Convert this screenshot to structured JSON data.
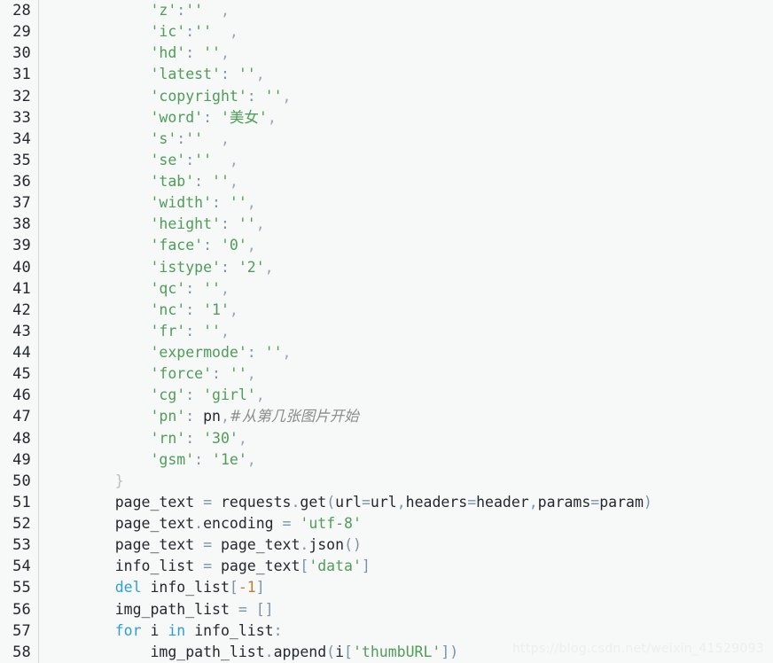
{
  "editor": {
    "language": "python",
    "background_color": "#f7f8f8",
    "gutter_separator_color": "#d4d6d9",
    "first_line_number": 28,
    "last_line_number": 58,
    "colors": {
      "string": "#4f9d58",
      "keyword": "#2d9fd6",
      "operator": "#7b93a8",
      "number": "#c07c32",
      "comment": "#8b8b8b",
      "identifier": "#24292e",
      "line_number": "#24292e",
      "brace": "#b9bec4"
    }
  },
  "watermark": {
    "text": "https://blog.csdn.net/weixin_41529093"
  },
  "lines": [
    {
      "n": "28",
      "text": "        'z':''  ,"
    },
    {
      "n": "29",
      "text": "        'ic':''  ,"
    },
    {
      "n": "30",
      "text": "        'hd': '',"
    },
    {
      "n": "31",
      "text": "        'latest': '',"
    },
    {
      "n": "32",
      "text": "        'copyright': '',"
    },
    {
      "n": "33",
      "text": "        'word': '美女',"
    },
    {
      "n": "34",
      "text": "        's':''  ,"
    },
    {
      "n": "35",
      "text": "        'se':''  ,"
    },
    {
      "n": "36",
      "text": "        'tab': '',"
    },
    {
      "n": "37",
      "text": "        'width': '',"
    },
    {
      "n": "38",
      "text": "        'height': '',"
    },
    {
      "n": "39",
      "text": "        'face': '0',"
    },
    {
      "n": "40",
      "text": "        'istype': '2',"
    },
    {
      "n": "41",
      "text": "        'qc': '',"
    },
    {
      "n": "42",
      "text": "        'nc': '1',"
    },
    {
      "n": "43",
      "text": "        'fr': '',"
    },
    {
      "n": "44",
      "text": "        'expermode': '',"
    },
    {
      "n": "45",
      "text": "        'force': '',"
    },
    {
      "n": "46",
      "text": "        'cg': 'girl',"
    },
    {
      "n": "47",
      "text": "        'pn': pn,#从第几张图片开始"
    },
    {
      "n": "48",
      "text": "        'rn': '30',"
    },
    {
      "n": "49",
      "text": "        'gsm': '1e',"
    },
    {
      "n": "50",
      "text": "    }"
    },
    {
      "n": "51",
      "text": "    page_text = requests.get(url=url,headers=header,params=param)"
    },
    {
      "n": "52",
      "text": "    page_text.encoding = 'utf-8'"
    },
    {
      "n": "53",
      "text": "    page_text = page_text.json()"
    },
    {
      "n": "54",
      "text": "    info_list = page_text['data']"
    },
    {
      "n": "55",
      "text": "    del info_list[-1]"
    },
    {
      "n": "56",
      "text": "    img_path_list = []"
    },
    {
      "n": "57",
      "text": "    for i in info_list:"
    },
    {
      "n": "58",
      "text": "        img_path_list.append(i['thumbURL'])"
    }
  ],
  "tokens": {
    "28": [
      {
        "c": "plain",
        "t": "        "
      },
      {
        "c": "tok-str",
        "t": "'z'"
      },
      {
        "c": "tok-op",
        "t": ":"
      },
      {
        "c": "tok-str",
        "t": "''"
      },
      {
        "c": "plain",
        "t": "  "
      },
      {
        "c": "tok-punc",
        "t": ","
      }
    ],
    "29": [
      {
        "c": "plain",
        "t": "        "
      },
      {
        "c": "tok-str",
        "t": "'ic'"
      },
      {
        "c": "tok-op",
        "t": ":"
      },
      {
        "c": "tok-str",
        "t": "''"
      },
      {
        "c": "plain",
        "t": "  "
      },
      {
        "c": "tok-punc",
        "t": ","
      }
    ],
    "30": [
      {
        "c": "plain",
        "t": "        "
      },
      {
        "c": "tok-str",
        "t": "'hd'"
      },
      {
        "c": "tok-op",
        "t": ":"
      },
      {
        "c": "plain",
        "t": " "
      },
      {
        "c": "tok-str",
        "t": "''"
      },
      {
        "c": "tok-punc",
        "t": ","
      }
    ],
    "31": [
      {
        "c": "plain",
        "t": "        "
      },
      {
        "c": "tok-str",
        "t": "'latest'"
      },
      {
        "c": "tok-op",
        "t": ":"
      },
      {
        "c": "plain",
        "t": " "
      },
      {
        "c": "tok-str",
        "t": "''"
      },
      {
        "c": "tok-punc",
        "t": ","
      }
    ],
    "32": [
      {
        "c": "plain",
        "t": "        "
      },
      {
        "c": "tok-str",
        "t": "'copyright'"
      },
      {
        "c": "tok-op",
        "t": ":"
      },
      {
        "c": "plain",
        "t": " "
      },
      {
        "c": "tok-str",
        "t": "''"
      },
      {
        "c": "tok-punc",
        "t": ","
      }
    ],
    "33": [
      {
        "c": "plain",
        "t": "        "
      },
      {
        "c": "tok-str",
        "t": "'word'"
      },
      {
        "c": "tok-op",
        "t": ":"
      },
      {
        "c": "plain",
        "t": " "
      },
      {
        "c": "tok-str",
        "t": "'"
      },
      {
        "c": "tok-cn",
        "t": "美女"
      },
      {
        "c": "tok-str",
        "t": "'"
      },
      {
        "c": "tok-punc",
        "t": ","
      }
    ],
    "34": [
      {
        "c": "plain",
        "t": "        "
      },
      {
        "c": "tok-str",
        "t": "'s'"
      },
      {
        "c": "tok-op",
        "t": ":"
      },
      {
        "c": "tok-str",
        "t": "''"
      },
      {
        "c": "plain",
        "t": "  "
      },
      {
        "c": "tok-punc",
        "t": ","
      }
    ],
    "35": [
      {
        "c": "plain",
        "t": "        "
      },
      {
        "c": "tok-str",
        "t": "'se'"
      },
      {
        "c": "tok-op",
        "t": ":"
      },
      {
        "c": "tok-str",
        "t": "''"
      },
      {
        "c": "plain",
        "t": "  "
      },
      {
        "c": "tok-punc",
        "t": ","
      }
    ],
    "36": [
      {
        "c": "plain",
        "t": "        "
      },
      {
        "c": "tok-str",
        "t": "'tab'"
      },
      {
        "c": "tok-op",
        "t": ":"
      },
      {
        "c": "plain",
        "t": " "
      },
      {
        "c": "tok-str",
        "t": "''"
      },
      {
        "c": "tok-punc",
        "t": ","
      }
    ],
    "37": [
      {
        "c": "plain",
        "t": "        "
      },
      {
        "c": "tok-str",
        "t": "'width'"
      },
      {
        "c": "tok-op",
        "t": ":"
      },
      {
        "c": "plain",
        "t": " "
      },
      {
        "c": "tok-str",
        "t": "''"
      },
      {
        "c": "tok-punc",
        "t": ","
      }
    ],
    "38": [
      {
        "c": "plain",
        "t": "        "
      },
      {
        "c": "tok-str",
        "t": "'height'"
      },
      {
        "c": "tok-op",
        "t": ":"
      },
      {
        "c": "plain",
        "t": " "
      },
      {
        "c": "tok-str",
        "t": "''"
      },
      {
        "c": "tok-punc",
        "t": ","
      }
    ],
    "39": [
      {
        "c": "plain",
        "t": "        "
      },
      {
        "c": "tok-str",
        "t": "'face'"
      },
      {
        "c": "tok-op",
        "t": ":"
      },
      {
        "c": "plain",
        "t": " "
      },
      {
        "c": "tok-str",
        "t": "'0'"
      },
      {
        "c": "tok-punc",
        "t": ","
      }
    ],
    "40": [
      {
        "c": "plain",
        "t": "        "
      },
      {
        "c": "tok-str",
        "t": "'istype'"
      },
      {
        "c": "tok-op",
        "t": ":"
      },
      {
        "c": "plain",
        "t": " "
      },
      {
        "c": "tok-str",
        "t": "'2'"
      },
      {
        "c": "tok-punc",
        "t": ","
      }
    ],
    "41": [
      {
        "c": "plain",
        "t": "        "
      },
      {
        "c": "tok-str",
        "t": "'qc'"
      },
      {
        "c": "tok-op",
        "t": ":"
      },
      {
        "c": "plain",
        "t": " "
      },
      {
        "c": "tok-str",
        "t": "''"
      },
      {
        "c": "tok-punc",
        "t": ","
      }
    ],
    "42": [
      {
        "c": "plain",
        "t": "        "
      },
      {
        "c": "tok-str",
        "t": "'nc'"
      },
      {
        "c": "tok-op",
        "t": ":"
      },
      {
        "c": "plain",
        "t": " "
      },
      {
        "c": "tok-str",
        "t": "'1'"
      },
      {
        "c": "tok-punc",
        "t": ","
      }
    ],
    "43": [
      {
        "c": "plain",
        "t": "        "
      },
      {
        "c": "tok-str",
        "t": "'fr'"
      },
      {
        "c": "tok-op",
        "t": ":"
      },
      {
        "c": "plain",
        "t": " "
      },
      {
        "c": "tok-str",
        "t": "''"
      },
      {
        "c": "tok-punc",
        "t": ","
      }
    ],
    "44": [
      {
        "c": "plain",
        "t": "        "
      },
      {
        "c": "tok-str",
        "t": "'expermode'"
      },
      {
        "c": "tok-op",
        "t": ":"
      },
      {
        "c": "plain",
        "t": " "
      },
      {
        "c": "tok-str",
        "t": "''"
      },
      {
        "c": "tok-punc",
        "t": ","
      }
    ],
    "45": [
      {
        "c": "plain",
        "t": "        "
      },
      {
        "c": "tok-str",
        "t": "'force'"
      },
      {
        "c": "tok-op",
        "t": ":"
      },
      {
        "c": "plain",
        "t": " "
      },
      {
        "c": "tok-str",
        "t": "''"
      },
      {
        "c": "tok-punc",
        "t": ","
      }
    ],
    "46": [
      {
        "c": "plain",
        "t": "        "
      },
      {
        "c": "tok-str",
        "t": "'cg'"
      },
      {
        "c": "tok-op",
        "t": ":"
      },
      {
        "c": "plain",
        "t": " "
      },
      {
        "c": "tok-str",
        "t": "'girl'"
      },
      {
        "c": "tok-punc",
        "t": ","
      }
    ],
    "47": [
      {
        "c": "plain",
        "t": "        "
      },
      {
        "c": "tok-str",
        "t": "'pn'"
      },
      {
        "c": "tok-op",
        "t": ":"
      },
      {
        "c": "plain",
        "t": " "
      },
      {
        "c": "tok-id",
        "t": "pn"
      },
      {
        "c": "tok-punc",
        "t": ","
      },
      {
        "c": "tok-cmt",
        "t": "#从第几张图片开始"
      }
    ],
    "48": [
      {
        "c": "plain",
        "t": "        "
      },
      {
        "c": "tok-str",
        "t": "'rn'"
      },
      {
        "c": "tok-op",
        "t": ":"
      },
      {
        "c": "plain",
        "t": " "
      },
      {
        "c": "tok-str",
        "t": "'30'"
      },
      {
        "c": "tok-punc",
        "t": ","
      }
    ],
    "49": [
      {
        "c": "plain",
        "t": "        "
      },
      {
        "c": "tok-str",
        "t": "'gsm'"
      },
      {
        "c": "tok-op",
        "t": ":"
      },
      {
        "c": "plain",
        "t": " "
      },
      {
        "c": "tok-str",
        "t": "'1e'"
      },
      {
        "c": "tok-punc",
        "t": ","
      }
    ],
    "50": [
      {
        "c": "plain",
        "t": "    "
      },
      {
        "c": "tok-brace",
        "t": "}"
      }
    ],
    "51": [
      {
        "c": "plain",
        "t": "    "
      },
      {
        "c": "tok-id",
        "t": "page_text"
      },
      {
        "c": "plain",
        "t": " "
      },
      {
        "c": "tok-op",
        "t": "="
      },
      {
        "c": "plain",
        "t": " "
      },
      {
        "c": "tok-id",
        "t": "requests"
      },
      {
        "c": "tok-op",
        "t": "."
      },
      {
        "c": "tok-id",
        "t": "get"
      },
      {
        "c": "tok-op",
        "t": "("
      },
      {
        "c": "tok-id",
        "t": "url"
      },
      {
        "c": "tok-op",
        "t": "="
      },
      {
        "c": "tok-id",
        "t": "url"
      },
      {
        "c": "tok-op",
        "t": ","
      },
      {
        "c": "tok-id",
        "t": "headers"
      },
      {
        "c": "tok-op",
        "t": "="
      },
      {
        "c": "tok-id",
        "t": "header"
      },
      {
        "c": "tok-op",
        "t": ","
      },
      {
        "c": "tok-id",
        "t": "params"
      },
      {
        "c": "tok-op",
        "t": "="
      },
      {
        "c": "tok-id",
        "t": "param"
      },
      {
        "c": "tok-op",
        "t": ")"
      }
    ],
    "52": [
      {
        "c": "plain",
        "t": "    "
      },
      {
        "c": "tok-id",
        "t": "page_text"
      },
      {
        "c": "tok-op",
        "t": "."
      },
      {
        "c": "tok-id",
        "t": "encoding"
      },
      {
        "c": "plain",
        "t": " "
      },
      {
        "c": "tok-op",
        "t": "="
      },
      {
        "c": "plain",
        "t": " "
      },
      {
        "c": "tok-str",
        "t": "'utf-8'"
      }
    ],
    "53": [
      {
        "c": "plain",
        "t": "    "
      },
      {
        "c": "tok-id",
        "t": "page_text"
      },
      {
        "c": "plain",
        "t": " "
      },
      {
        "c": "tok-op",
        "t": "="
      },
      {
        "c": "plain",
        "t": " "
      },
      {
        "c": "tok-id",
        "t": "page_text"
      },
      {
        "c": "tok-op",
        "t": "."
      },
      {
        "c": "tok-id",
        "t": "json"
      },
      {
        "c": "tok-op",
        "t": "()"
      }
    ],
    "54": [
      {
        "c": "plain",
        "t": "    "
      },
      {
        "c": "tok-id",
        "t": "info_list"
      },
      {
        "c": "plain",
        "t": " "
      },
      {
        "c": "tok-op",
        "t": "="
      },
      {
        "c": "plain",
        "t": " "
      },
      {
        "c": "tok-id",
        "t": "page_text"
      },
      {
        "c": "tok-op",
        "t": "["
      },
      {
        "c": "tok-str",
        "t": "'data'"
      },
      {
        "c": "tok-op",
        "t": "]"
      }
    ],
    "55": [
      {
        "c": "plain",
        "t": "    "
      },
      {
        "c": "tok-kw",
        "t": "del"
      },
      {
        "c": "plain",
        "t": " "
      },
      {
        "c": "tok-id",
        "t": "info_list"
      },
      {
        "c": "tok-op",
        "t": "["
      },
      {
        "c": "tok-num",
        "t": "-1"
      },
      {
        "c": "tok-op",
        "t": "]"
      }
    ],
    "56": [
      {
        "c": "plain",
        "t": "    "
      },
      {
        "c": "tok-id",
        "t": "img_path_list"
      },
      {
        "c": "plain",
        "t": " "
      },
      {
        "c": "tok-op",
        "t": "="
      },
      {
        "c": "plain",
        "t": " "
      },
      {
        "c": "tok-op",
        "t": "[]"
      }
    ],
    "57": [
      {
        "c": "plain",
        "t": "    "
      },
      {
        "c": "tok-kw",
        "t": "for"
      },
      {
        "c": "plain",
        "t": " "
      },
      {
        "c": "tok-id",
        "t": "i"
      },
      {
        "c": "plain",
        "t": " "
      },
      {
        "c": "tok-kw",
        "t": "in"
      },
      {
        "c": "plain",
        "t": " "
      },
      {
        "c": "tok-id",
        "t": "info_list"
      },
      {
        "c": "tok-op",
        "t": ":"
      }
    ],
    "58": [
      {
        "c": "plain",
        "t": "        "
      },
      {
        "c": "tok-id",
        "t": "img_path_list"
      },
      {
        "c": "tok-op",
        "t": "."
      },
      {
        "c": "tok-id",
        "t": "append"
      },
      {
        "c": "tok-op",
        "t": "("
      },
      {
        "c": "tok-id",
        "t": "i"
      },
      {
        "c": "tok-op",
        "t": "["
      },
      {
        "c": "tok-str",
        "t": "'thumbURL'"
      },
      {
        "c": "tok-op",
        "t": "]"
      },
      {
        "c": "tok-op",
        "t": ")"
      }
    ]
  }
}
